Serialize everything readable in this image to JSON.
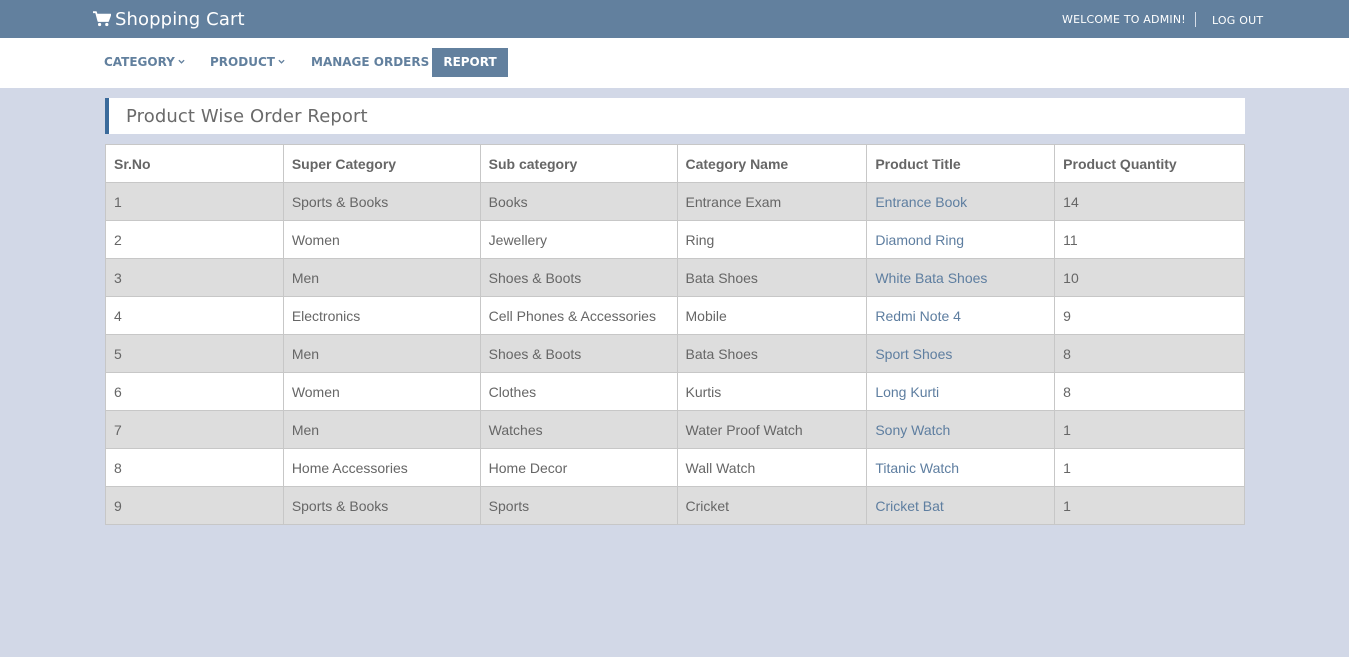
{
  "header": {
    "brand": "Shopping Cart",
    "brand_icon": "shopping-cart-icon",
    "welcome": "WELCOME TO ADMIN!",
    "logout": "LOG OUT",
    "bar_color": "#62809e"
  },
  "nav": {
    "category": "CATEGORY",
    "product": "PRODUCT",
    "manage_orders": "MANAGE ORDERS",
    "report": "REPORT",
    "active": "REPORT"
  },
  "panel": {
    "title": "Product Wise Order Report",
    "accent": "#3a6a9b"
  },
  "table": {
    "headers": [
      "Sr.No",
      "Super Category",
      "Sub category",
      "Category Name",
      "Product Title",
      "Product Quantity"
    ],
    "rows": [
      [
        "1",
        "Sports & Books",
        "Books",
        "Entrance Exam",
        "Entrance Book",
        "14"
      ],
      [
        "2",
        "Women",
        "Jewellery",
        "Ring",
        "Diamond Ring",
        "11"
      ],
      [
        "3",
        "Men",
        "Shoes & Boots",
        "Bata Shoes",
        "White Bata Shoes",
        "10"
      ],
      [
        "4",
        "Electronics",
        "Cell Phones & Accessories",
        "Mobile",
        "Redmi Note 4",
        "9"
      ],
      [
        "5",
        "Men",
        "Shoes & Boots",
        "Bata Shoes",
        "Sport Shoes",
        "8"
      ],
      [
        "6",
        "Women",
        "Clothes",
        "Kurtis",
        "Long Kurti",
        "8"
      ],
      [
        "7",
        "Men",
        "Watches",
        "Water Proof Watch",
        "Sony Watch",
        "1"
      ],
      [
        "8",
        "Home Accessories",
        "Home Decor",
        "Wall Watch",
        "Titanic Watch",
        "1"
      ],
      [
        "9",
        "Sports & Books",
        "Sports",
        "Cricket",
        "Cricket Bat",
        "1"
      ]
    ]
  }
}
